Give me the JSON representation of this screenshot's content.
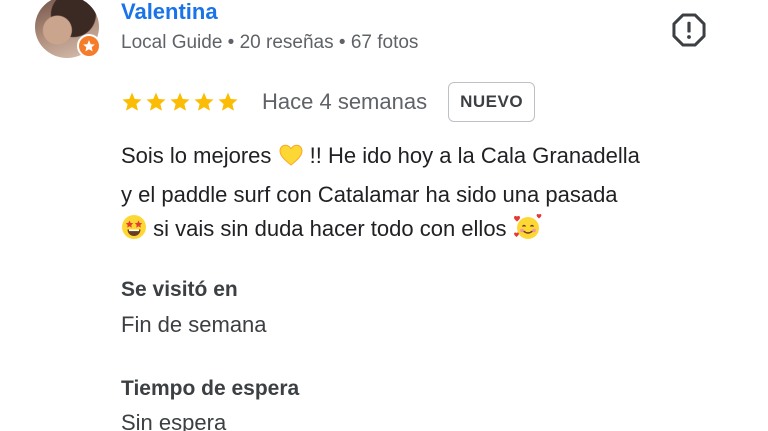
{
  "reviewer": {
    "name": "Valentina",
    "meta": "Local Guide • 20 reseñas • 67 fotos"
  },
  "review": {
    "rating": 5,
    "rating_max": 5,
    "date": "Hace 4 semanas",
    "new_badge": "NUEVO",
    "text_line_1_a": "Sois lo mejores",
    "text_line_1_b": "!! He ido hoy a la Cala Granadella",
    "text_line_2": "y el paddle surf con Catalamar ha sido una pasada",
    "text_line_3": "si vais sin duda hacer todo con ellos"
  },
  "details": {
    "visited_label": "Se visitó en",
    "visited_value": "Fin de semana",
    "wait_label": "Tiempo de espera",
    "wait_value": "Sin espera"
  },
  "icons": {
    "report": "report-icon",
    "star": "star-icon",
    "local_guide": "local-guide-badge-icon",
    "emoji_heart": "yellow-heart-emoji",
    "emoji_star_eyes": "star-struck-emoji",
    "emoji_hearts_face": "smiling-face-with-hearts-emoji"
  },
  "colors": {
    "name": "#1a73e8",
    "star": "#fbbc04",
    "badge": "#f57c2b",
    "muted": "#5f6368"
  }
}
